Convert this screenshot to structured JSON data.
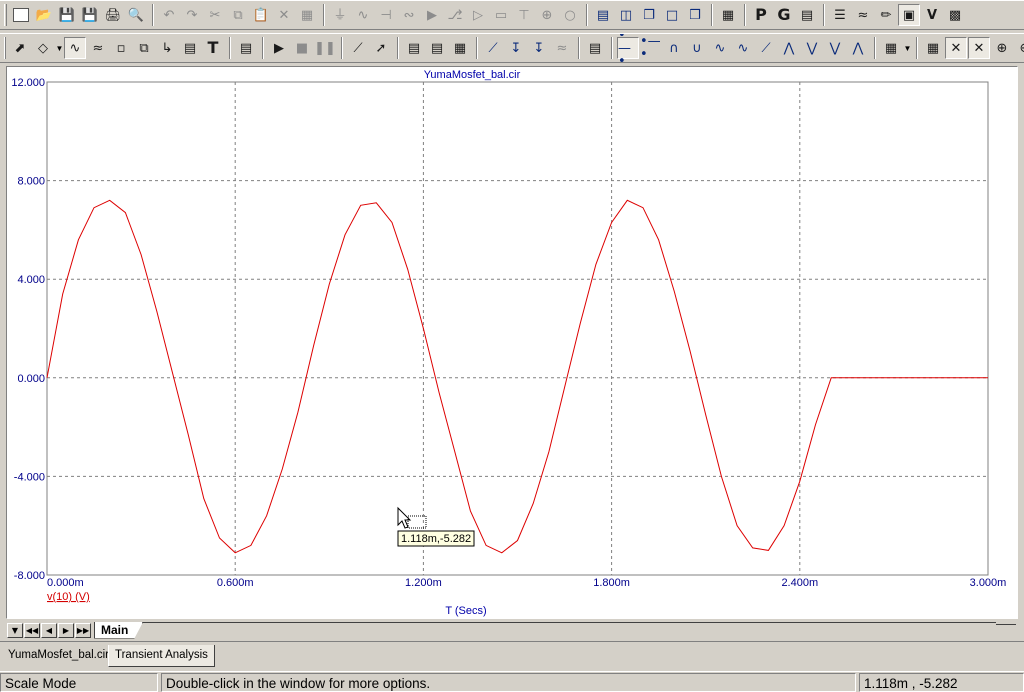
{
  "chart_data": {
    "type": "line",
    "title": "YumaMosfet_bal.cir",
    "xlabel": "T (Secs)",
    "ylabel": "",
    "xlim": [
      0,
      0.003
    ],
    "ylim": [
      -8,
      12
    ],
    "x_ticks": [
      0,
      0.0006,
      0.0012,
      0.0018,
      0.0024,
      0.003
    ],
    "x_tick_labels": [
      "0.000m",
      "0.600m",
      "1.200m",
      "1.800m",
      "2.400m",
      "3.000m"
    ],
    "y_ticks": [
      12,
      8,
      4,
      0,
      -4,
      -8
    ],
    "y_tick_labels": [
      "12.000",
      "8.000",
      "4.000",
      "0.000",
      "-4.000",
      "-8.000"
    ],
    "grid": true,
    "series": [
      {
        "name": "v(10) (V)",
        "color": "#dd0000",
        "x": [
          0,
          5e-05,
          0.0001,
          0.00015,
          0.0002,
          0.00025,
          0.0003,
          0.00035,
          0.0004,
          0.00045,
          0.0005,
          0.00055,
          0.0006,
          0.00065,
          0.0007,
          0.00075,
          0.0008,
          0.00085,
          0.0009,
          0.00095,
          0.001,
          0.00105,
          0.0011,
          0.00115,
          0.0012,
          0.00125,
          0.0013,
          0.00135,
          0.0014,
          0.00145,
          0.0015,
          0.00155,
          0.0016,
          0.00165,
          0.0017,
          0.00175,
          0.0018,
          0.00185,
          0.0019,
          0.00195,
          0.002,
          0.00205,
          0.0021,
          0.00215,
          0.0022,
          0.00225,
          0.0023,
          0.00235,
          0.0024,
          0.00245,
          0.0025,
          0.00255,
          0.0026,
          0.00265,
          0.0027,
          0.00275,
          0.0028,
          0.00285,
          0.0029,
          0.00295,
          0.003
        ],
        "y": [
          0.0,
          3.4,
          5.6,
          6.9,
          7.2,
          6.7,
          5.0,
          2.7,
          0.2,
          -2.3,
          -4.9,
          -6.5,
          -7.1,
          -6.8,
          -5.6,
          -3.7,
          -1.4,
          1.3,
          3.8,
          5.8,
          7.0,
          7.1,
          6.3,
          4.4,
          2.0,
          -0.6,
          -3.0,
          -5.4,
          -6.8,
          -7.1,
          -6.6,
          -5.1,
          -3.0,
          -0.4,
          2.2,
          4.6,
          6.3,
          7.2,
          6.9,
          5.6,
          3.5,
          1.1,
          -1.5,
          -4.0,
          -6.0,
          -6.9,
          -7.0,
          -6.0,
          -4.2,
          -1.9,
          0.0,
          0.0,
          0.0,
          0.0,
          0.0,
          0.0,
          0.0,
          0.0,
          0.0,
          0.0,
          0.0
        ]
      }
    ]
  },
  "cursor_tip": "1.118m,-5.282",
  "page_tabs": {
    "active": "Main"
  },
  "doc_tabs": [
    "YumaMosfet_bal.cir",
    "Transient Analysis"
  ],
  "status": {
    "mode": "Scale Mode",
    "hint": "Double-click in the window for more options.",
    "coords": "1.118m , -5.282"
  },
  "toolbar1": {
    "icons": [
      "new-file-icon",
      "open-folder-icon",
      "save-icon",
      "save-all-icon",
      "print-icon",
      "print-preview-icon",
      "undo-icon",
      "redo-icon",
      "cut-icon",
      "copy-icon",
      "paste-icon",
      "delete-icon",
      "select-all-icon",
      "ground-icon",
      "resistor-icon",
      "capacitor-icon",
      "inductor-icon",
      "diode-icon",
      "transistor-icon",
      "opamp-icon",
      "source-icon",
      "battery-icon",
      "flag-icon",
      "node-icon",
      "tile-horizontal-icon",
      "tile-vertical-icon",
      "cascade-icon",
      "maximize-icon",
      "restore-icon",
      "calculator-icon",
      "properties-icon",
      "grid-icon",
      "component-panel-icon",
      "values-icon",
      "waveform-icon",
      "probe-icon",
      "scope-icon",
      "voltage-display-icon",
      "window-icon"
    ],
    "letters": {
      "properties-icon": "P",
      "grid-icon": "G",
      "voltage-display-icon": "V"
    }
  },
  "toolbar2": {
    "icons": [
      "select-arrow-icon",
      "shape-select-icon",
      "add-waveform-icon",
      "waveform-sine-icon",
      "box-zoom-icon",
      "scale-icon",
      "trace-icon",
      "scope-view-icon",
      "text-icon",
      "properties-dialog-icon",
      "run-icon",
      "stop-icon",
      "pause-icon",
      "line-tool-icon",
      "arrow-line-icon",
      "grid-pattern-1-icon",
      "grid-pattern-2-icon",
      "grid-pattern-3-icon",
      "cursor-mode-icon",
      "left-cursor-icon",
      "right-cursor-icon",
      "data-points-icon",
      "plot-stack-icon",
      "peak-icon",
      "valley-icon",
      "high-icon",
      "low-icon",
      "inflection-icon",
      "global-high-icon",
      "global-low-icon",
      "top-icon",
      "bottom-icon",
      "slope-icon",
      "3d-chart-icon",
      "table-icon",
      "left-cursor-move-icon",
      "right-cursor-move-icon",
      "zoom-in-icon",
      "zoom-out-icon"
    ],
    "letters": {
      "text-icon": "T"
    }
  },
  "theme": {
    "face": "#d4d0c8",
    "plot_bg": "#ffffff",
    "grid": "#808080",
    "axis_text": "#00008b",
    "trace": "#dd0000"
  }
}
